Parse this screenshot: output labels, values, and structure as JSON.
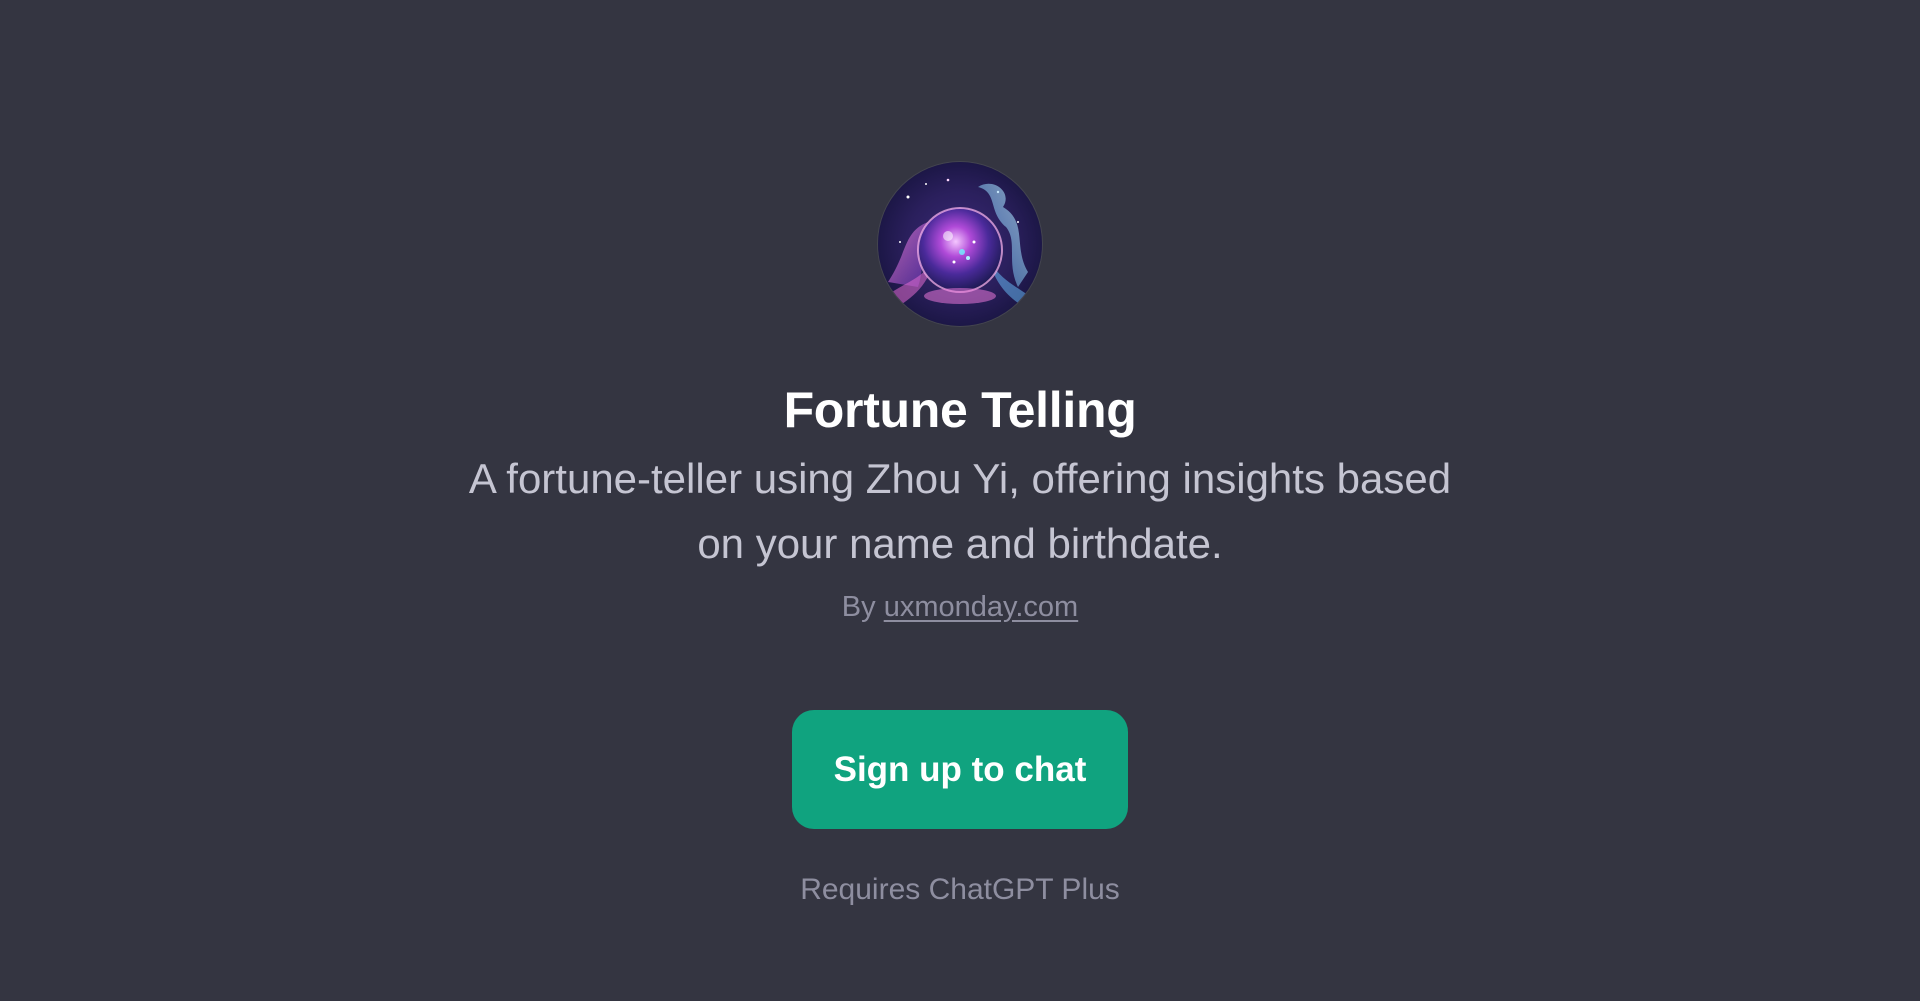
{
  "gpt": {
    "title": "Fortune Telling",
    "description": "A fortune-teller using Zhou Yi, offering insights based on your name and birthdate.",
    "author_prefix": "By",
    "author_link": "uxmonday.com",
    "avatar_icon": "crystal-ball-icon"
  },
  "actions": {
    "signup_label": "Sign up to chat",
    "requirement_note": "Requires ChatGPT Plus"
  },
  "colors": {
    "background": "#343541",
    "accent": "#10a37f",
    "title": "#ffffff",
    "description": "#c5c5d2",
    "muted": "#8e8ea0"
  }
}
